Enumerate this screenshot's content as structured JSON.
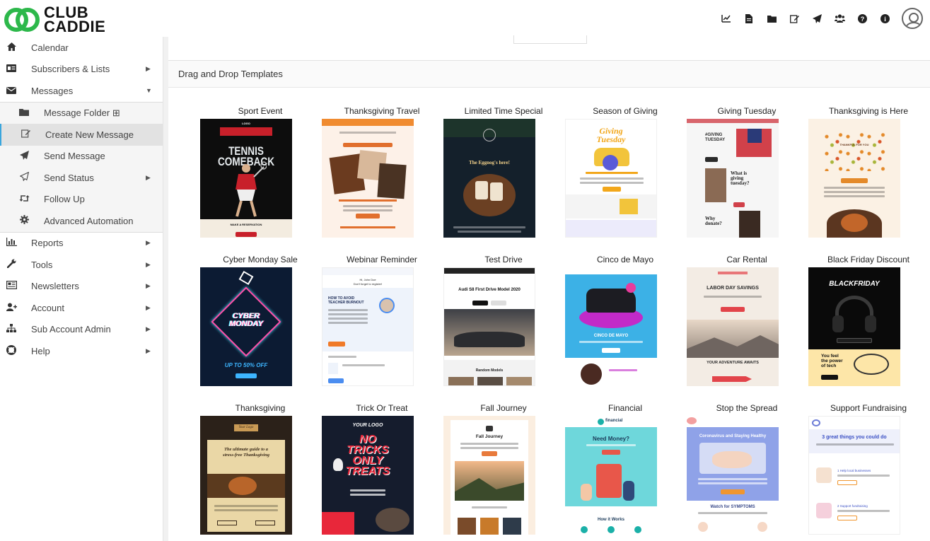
{
  "brand": {
    "line1": "CLUB",
    "line2": "CADDIE",
    "color": "#2db84b"
  },
  "header_icons": [
    "chart-icon",
    "document-icon",
    "folder-icon",
    "edit-icon",
    "send-icon",
    "users-icon",
    "help-icon",
    "info-icon"
  ],
  "sidebar": {
    "items": [
      {
        "label": "Calendar",
        "icon": "calendar-icon"
      },
      {
        "label": "Subscribers & Lists",
        "icon": "address-card-icon"
      },
      {
        "label": "Messages",
        "icon": "envelope-icon"
      }
    ],
    "messages_children": [
      {
        "label": "Message Folder ⊞",
        "icon": "folder-icon"
      },
      {
        "label": "Create New Message",
        "icon": "edit-icon"
      },
      {
        "label": "Send Message",
        "icon": "send-icon"
      },
      {
        "label": "Send Status",
        "icon": "send-outline-icon"
      },
      {
        "label": "Follow Up",
        "icon": "retweet-icon"
      },
      {
        "label": "Advanced Automation",
        "icon": "gear-icon"
      }
    ],
    "lower_items": [
      {
        "label": "Reports",
        "icon": "bar-chart-icon"
      },
      {
        "label": "Tools",
        "icon": "wrench-icon"
      },
      {
        "label": "Newsletters",
        "icon": "newspaper-icon"
      },
      {
        "label": "Account",
        "icon": "add-user-icon"
      },
      {
        "label": "Sub Account Admin",
        "icon": "sitemap-icon"
      },
      {
        "label": "Help",
        "icon": "life-ring-icon"
      }
    ]
  },
  "main": {
    "section_title": "Drag and Drop Templates",
    "templates": [
      {
        "title": "Sport Event",
        "bg": "#0d0d0d"
      },
      {
        "title": "Thanksgiving Travel",
        "bg": "#fdf1e8"
      },
      {
        "title": "Limited Time Special",
        "bg": "#14202b"
      },
      {
        "title": "Season of Giving",
        "bg": "#ffffff"
      },
      {
        "title": "Giving Tuesday",
        "bg": "#f6f6f6"
      },
      {
        "title": "Thanksgiving is Here",
        "bg": "#fbf1e4"
      },
      {
        "title": "Cyber Monday Sale",
        "bg": "#0c1b33"
      },
      {
        "title": "Webinar Reminder",
        "bg": "#ffffff"
      },
      {
        "title": "Test Drive",
        "bg": "#ffffff"
      },
      {
        "title": "Cinco de Mayo",
        "bg": "#3cb1e6"
      },
      {
        "title": "Car Rental",
        "bg": "#f3ece4"
      },
      {
        "title": "Black Friday Discount",
        "bg": "#0a0a0a"
      },
      {
        "title": "Thanksgiving",
        "bg": "#2b2119"
      },
      {
        "title": "Trick Or Treat",
        "bg": "#151c2d"
      },
      {
        "title": "Fall Journey",
        "bg": "#fbeee0"
      },
      {
        "title": "Financial",
        "bg": "#e8f7f7"
      },
      {
        "title": "Stop the Spread",
        "bg": "#e9ecf7"
      },
      {
        "title": "Support Fundraising",
        "bg": "#ffffff"
      }
    ],
    "thumb_text": {
      "sport_logo": "LOGO",
      "sport_big": "TENNIS\nCOMEBACK",
      "sport_cta": "MAKE A RESERVATION",
      "limited_heading": "The Eggnog's here!",
      "giving_season": "Giving\nTuesday",
      "giving_tues": "#GIVING\nTUESDAY",
      "giving_q": "What is\ngiving\ntuesday?",
      "giving_why": "Why\ndonate?",
      "thx_here": "THANKFUL FOR YOU",
      "cyber": "CYBER\nMONDAY",
      "cyber_sub": "UP TO 50% OFF",
      "webinar_hi": "Hi, John Doe\nDon't forget to register!",
      "webinar_title": "HOW TO AVOID\nTEACHER BURNOUT",
      "test_model": "Audi S8 First Drive Model 2020",
      "test_more": "Random Models",
      "cinco": "CINCO DE MAYO",
      "car_labor": "LABOR DAY SAVINGS",
      "car_adv": "YOUR ADVENTURE AWAITS",
      "bf_title": "BLACKFRIDAY",
      "bf_power": "You feel\nthe power\nof tech",
      "thx_logo": "Your Logo",
      "thx_guide": "The ultimate guide to a\nstress-free Thanksgiving",
      "trick_logo": "YOUR LOGO",
      "trick_big": "NO\nTRICKS\nONLY\nTREATS",
      "fall_title": "Fall Journey",
      "fin_logo": "financial",
      "fin_need": "Need Money?",
      "fin_how": "How it Works",
      "stop_title": "Coronavirus and Staying Healthy",
      "stop_watch": "Watch for SYMPTOMS",
      "fund_title": "3 great things you could do",
      "fund_1": "1 Help local businesses",
      "fund_2": "2 Support fundraising"
    }
  }
}
